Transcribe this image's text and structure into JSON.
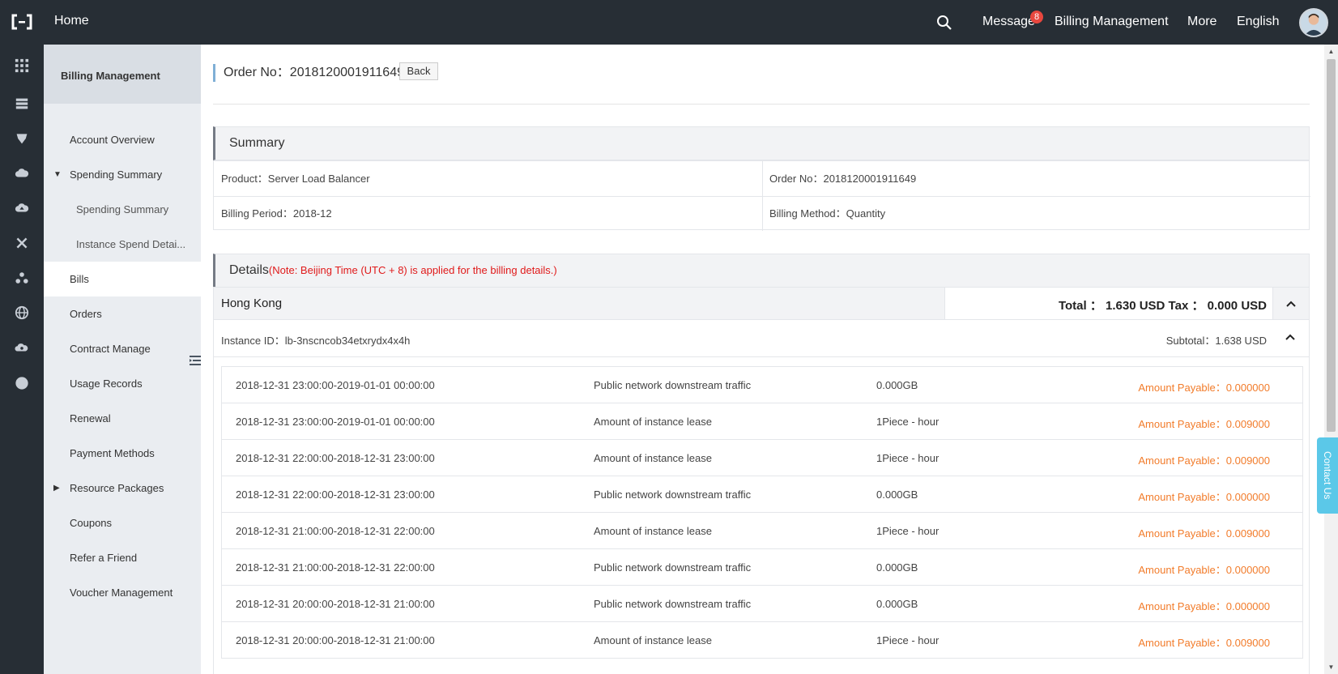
{
  "topbar": {
    "home": "Home",
    "message": "Message",
    "message_badge": "8",
    "billing": "Billing Management",
    "more": "More",
    "language": "English"
  },
  "rail_icons": [
    "apps-icon",
    "server-icon",
    "shield-icon",
    "cloud-icon",
    "cloud-upload-icon",
    "network-icon",
    "cluster-icon",
    "globe-icon",
    "gear-cloud-icon",
    "circle-icon"
  ],
  "sidebar": {
    "title": "Billing Management",
    "items": [
      {
        "label": "Account Overview"
      },
      {
        "label": "Spending Summary"
      },
      {
        "label": "Spending Summary"
      },
      {
        "label": "Instance Spend Detai..."
      },
      {
        "label": "Bills"
      },
      {
        "label": "Orders"
      },
      {
        "label": "Contract Manage"
      },
      {
        "label": "Usage Records"
      },
      {
        "label": "Renewal"
      },
      {
        "label": "Payment Methods"
      },
      {
        "label": "Resource Packages"
      },
      {
        "label": "Coupons"
      },
      {
        "label": "Refer a Friend"
      },
      {
        "label": "Voucher Management"
      }
    ]
  },
  "order": {
    "heading": "Order No：2018120001911649",
    "back": "Back"
  },
  "summary": {
    "title": "Summary",
    "product": "Product：Server Load Balancer",
    "order_no": "Order No：2018120001911649",
    "billing_period": "Billing Period：2018-12",
    "billing_method": "Billing Method：Quantity"
  },
  "details": {
    "title": "Details",
    "note": "(Note: Beijing Time (UTC + 8) is applied for the billing details.)",
    "region": "Hong Kong",
    "total": "Total ： 1.630 USD  Tax ： 0.000 USD",
    "instance_id": "Instance ID：lb-3nscncob34etxrydx4x4h",
    "subtotal": "Subtotal：1.638 USD",
    "rows": [
      {
        "time": "2018-12-31 23:00:00-2019-01-01 00:00:00",
        "item": "Public network downstream traffic",
        "qty": "0.000GB",
        "amount": "Amount Payable：0.000000"
      },
      {
        "time": "2018-12-31 23:00:00-2019-01-01 00:00:00",
        "item": "Amount of instance lease",
        "qty": "1Piece - hour",
        "amount": "Amount Payable：0.009000"
      },
      {
        "time": "2018-12-31 22:00:00-2018-12-31 23:00:00",
        "item": "Amount of instance lease",
        "qty": "1Piece - hour",
        "amount": "Amount Payable：0.009000"
      },
      {
        "time": "2018-12-31 22:00:00-2018-12-31 23:00:00",
        "item": "Public network downstream traffic",
        "qty": "0.000GB",
        "amount": "Amount Payable：0.000000"
      },
      {
        "time": "2018-12-31 21:00:00-2018-12-31 22:00:00",
        "item": "Amount of instance lease",
        "qty": "1Piece - hour",
        "amount": "Amount Payable：0.009000"
      },
      {
        "time": "2018-12-31 21:00:00-2018-12-31 22:00:00",
        "item": "Public network downstream traffic",
        "qty": "0.000GB",
        "amount": "Amount Payable：0.000000"
      },
      {
        "time": "2018-12-31 20:00:00-2018-12-31 21:00:00",
        "item": "Public network downstream traffic",
        "qty": "0.000GB",
        "amount": "Amount Payable：0.000000"
      },
      {
        "time": "2018-12-31 20:00:00-2018-12-31 21:00:00",
        "item": "Amount of instance lease",
        "qty": "1Piece - hour",
        "amount": "Amount Payable：0.009000"
      }
    ]
  },
  "contact": "Contact Us",
  "colors": {
    "topbar": "#272e35",
    "accent_orange": "#f27c2b",
    "note_red": "#e01a1a",
    "contact": "#5bc8e8"
  }
}
